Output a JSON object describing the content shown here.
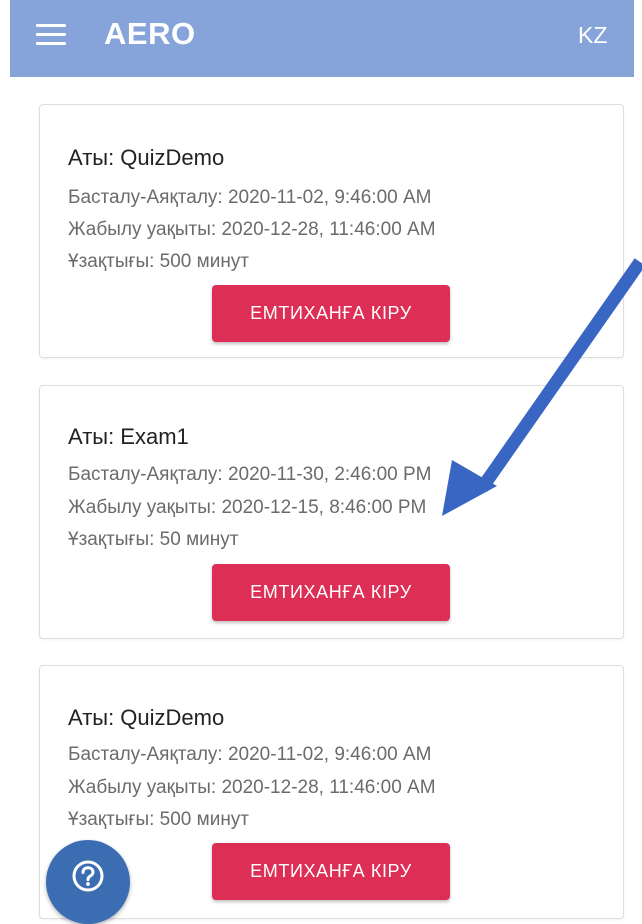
{
  "app": {
    "title": "AERO",
    "language": "KZ",
    "accent_color": "#86a4da",
    "button_color": "#dd2e55",
    "help_color": "#3c6db3"
  },
  "icons": {
    "menu": "hamburger-menu-icon",
    "help": "question-circle-icon",
    "annotation": "arrow-icon"
  },
  "exams": [
    {
      "name": "Аты: QuizDemo",
      "start_end": "Басталу-Аяқталу: 2020-11-02, 9:46:00 AM",
      "close_time": "Жабылу уақыты: 2020-12-28, 11:46:00 AM",
      "duration": "Ұзақтығы: 500 минут",
      "button_label": "ЕМТИХАНҒА КІРУ"
    },
    {
      "name": "Аты: Exam1",
      "start_end": "Басталу-Аяқталу: 2020-11-30, 2:46:00 PM",
      "close_time": "Жабылу уақыты: 2020-12-15, 8:46:00 PM",
      "duration": "Ұзақтығы: 50 минут",
      "button_label": "ЕМТИХАНҒА КІРУ"
    },
    {
      "name": "Аты: QuizDemo",
      "start_end": "Басталу-Аяқталу: 2020-11-02, 9:46:00 AM",
      "close_time": "Жабылу уақыты: 2020-12-28, 11:46:00 AM",
      "duration": "Ұзақтығы: 500 минут",
      "button_label": "ЕМТИХАНҒА КІРУ"
    }
  ]
}
